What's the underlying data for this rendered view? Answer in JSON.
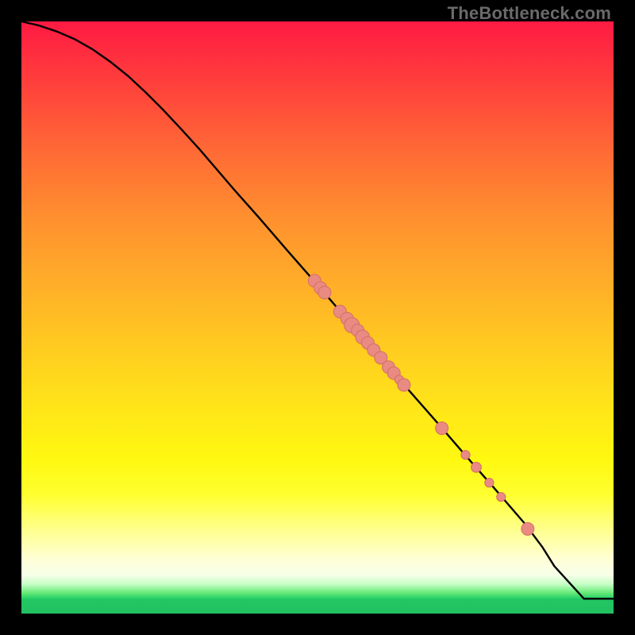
{
  "watermark": "TheBottleneck.com",
  "colors": {
    "background": "#000000",
    "curve": "#000000",
    "dot_fill": "#e98b82",
    "dot_stroke": "#d36e67",
    "watermark": "#6a6a6a"
  },
  "chart_data": {
    "type": "line",
    "title": "",
    "xlabel": "",
    "ylabel": "",
    "xlim": [
      0,
      100
    ],
    "ylim": [
      0,
      100
    ],
    "curve": {
      "x": [
        0,
        3,
        6,
        9,
        12,
        15,
        18,
        21,
        24,
        27,
        30,
        33,
        36,
        40,
        45,
        50,
        55,
        60,
        65,
        70,
        75,
        80,
        85,
        88,
        90,
        95,
        100
      ],
      "y": [
        100,
        99.3,
        98.3,
        97.0,
        95.3,
        93.2,
        90.8,
        88.0,
        85.0,
        81.8,
        78.5,
        75.0,
        71.5,
        67.0,
        61.2,
        55.5,
        49.7,
        44.0,
        38.2,
        32.5,
        26.7,
        21.0,
        15.2,
        11.2,
        8.0,
        2.5,
        2.5
      ]
    },
    "series": [
      {
        "name": "data-points",
        "points": [
          {
            "x": 49.5,
            "y": 56.2,
            "r": 1.0
          },
          {
            "x": 50.5,
            "y": 55.0,
            "r": 1.0
          },
          {
            "x": 51.2,
            "y": 54.2,
            "r": 1.0
          },
          {
            "x": 53.8,
            "y": 51.0,
            "r": 1.0
          },
          {
            "x": 55.0,
            "y": 49.8,
            "r": 1.0
          },
          {
            "x": 55.8,
            "y": 48.7,
            "r": 1.2
          },
          {
            "x": 56.8,
            "y": 47.8,
            "r": 1.0
          },
          {
            "x": 57.6,
            "y": 46.7,
            "r": 1.1
          },
          {
            "x": 58.5,
            "y": 45.7,
            "r": 1.0
          },
          {
            "x": 59.5,
            "y": 44.5,
            "r": 1.0
          },
          {
            "x": 60.7,
            "y": 43.2,
            "r": 1.0
          },
          {
            "x": 62.0,
            "y": 41.6,
            "r": 1.0
          },
          {
            "x": 62.9,
            "y": 40.6,
            "r": 1.0
          },
          {
            "x": 63.8,
            "y": 39.5,
            "r": 0.7
          },
          {
            "x": 64.6,
            "y": 38.6,
            "r": 1.0
          },
          {
            "x": 71.0,
            "y": 31.3,
            "r": 1.0
          },
          {
            "x": 75.0,
            "y": 26.8,
            "r": 0.7
          },
          {
            "x": 76.8,
            "y": 24.7,
            "r": 0.8
          },
          {
            "x": 79.0,
            "y": 22.1,
            "r": 0.7
          },
          {
            "x": 81.0,
            "y": 19.7,
            "r": 0.7
          },
          {
            "x": 85.5,
            "y": 14.3,
            "r": 1.0
          }
        ]
      }
    ]
  }
}
